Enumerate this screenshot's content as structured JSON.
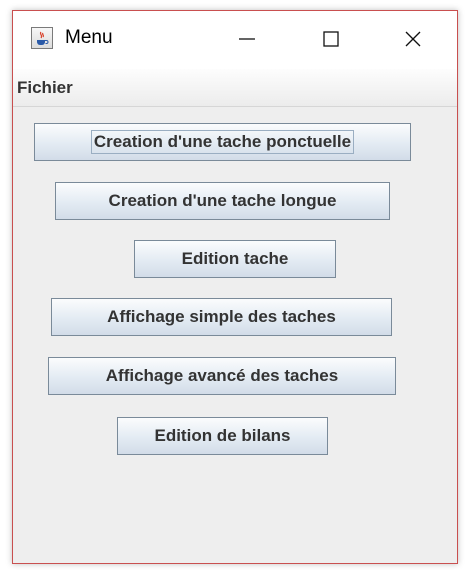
{
  "window": {
    "title": "Menu",
    "icon": "java-cup-icon",
    "controls": {
      "minimize_icon": "minimize-icon",
      "maximize_icon": "maximize-icon",
      "close_icon": "close-icon"
    }
  },
  "menubar": {
    "items": [
      {
        "label": "Fichier"
      }
    ]
  },
  "buttons": [
    {
      "label": "Creation d'une tache ponctuelle",
      "focused": true
    },
    {
      "label": "Creation d'une tache longue"
    },
    {
      "label": "Edition tache"
    },
    {
      "label": "Affichage simple des taches"
    },
    {
      "label": "Affichage avancé des taches"
    },
    {
      "label": "Edition de bilans"
    }
  ],
  "colors": {
    "window_border": "#c94f4f",
    "content_bg": "#eeeeee",
    "button_border": "#7a8a99",
    "button_text": "#333333"
  }
}
